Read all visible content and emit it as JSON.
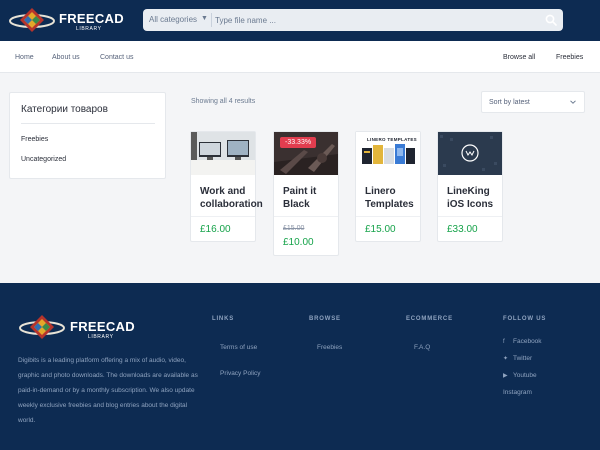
{
  "header": {
    "logo_text": "FREECAD",
    "logo_sub": "LIBRARY",
    "search": {
      "category_label": "All categories",
      "placeholder": "Type file name ..."
    }
  },
  "nav": {
    "left": [
      "Home",
      "About us",
      "Contact us"
    ],
    "right": [
      "Browse all",
      "Freebies"
    ]
  },
  "sidebar": {
    "title": "Категории товаров",
    "items": [
      "Freebies",
      "Uncategorized"
    ]
  },
  "shop": {
    "results_text": "Showing all 4 results",
    "sort_label": "Sort by latest",
    "products": [
      {
        "title": "Work and collaboration",
        "price": "£16.00"
      },
      {
        "title": "Paint it Black",
        "badge": "-33.33%",
        "old_price": "£15.00",
        "price": "£10.00"
      },
      {
        "title": "Linero Templates",
        "price": "£15.00",
        "image_caption": "LINERO TEMPLATES"
      },
      {
        "title": "LineKing iOS Icons",
        "price": "£33.00"
      }
    ]
  },
  "footer": {
    "about": "Digibits is a leading platform offering a mix of audio, video, graphic and photo downloads. The downloads are available as paid-in-demand or by a monthly subscription. We also update weekly exclusive freebies and blog entries about the digital world.",
    "columns": {
      "links": {
        "heading": "LINKS",
        "items": [
          "Terms of use",
          "Privacy Policy"
        ]
      },
      "browse": {
        "heading": "BROWSE",
        "items": [
          "Freebies"
        ]
      },
      "ecommerce": {
        "heading": "ECOMMERCE",
        "items": [
          "F.A.Q"
        ]
      },
      "follow": {
        "heading": "FOLLOW US",
        "items": [
          "Facebook",
          "Twitter",
          "Youtube",
          "Instagram"
        ]
      }
    }
  },
  "colors": {
    "navy": "#0d2b52",
    "accent_green": "#16a34a",
    "sale_red": "#e23d4f"
  },
  "icons": [
    "search-icon",
    "caret-down-icon",
    "chevron-down-icon",
    "facebook-icon",
    "twitter-icon",
    "youtube-icon"
  ]
}
